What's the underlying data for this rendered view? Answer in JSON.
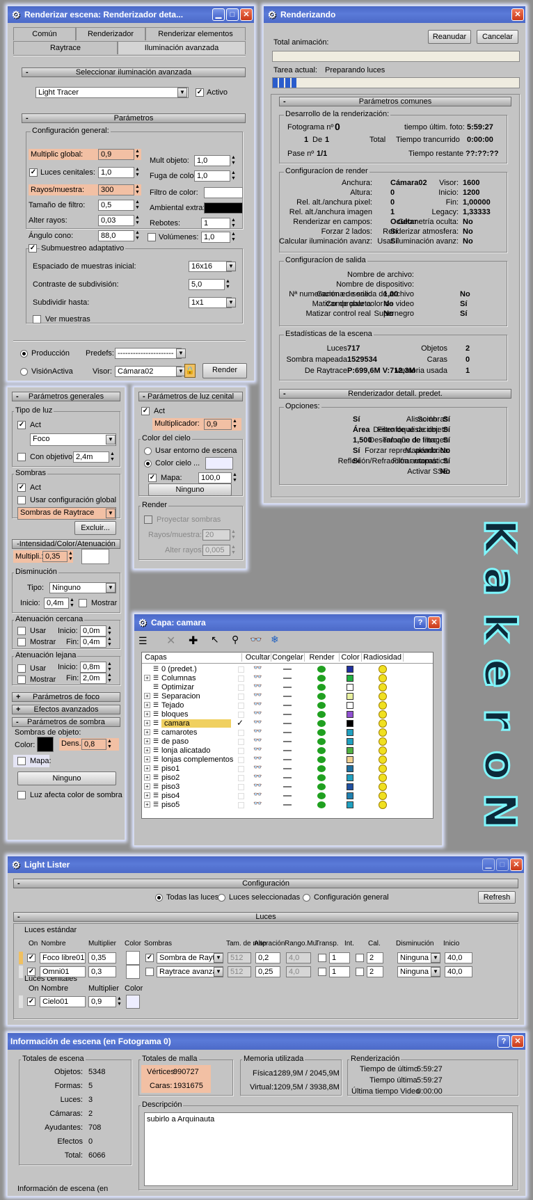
{
  "render_window": {
    "title": "Renderizar escena: Renderizador deta...",
    "tabs_row1": [
      "Común",
      "Renderizador",
      "Renderizar elementos"
    ],
    "tabs_row2": [
      "Raytrace",
      "Iluminación avanzada"
    ],
    "sel_rollout": "Seleccionar iluminación avanzada",
    "engine": "Light Tracer",
    "activo": "Activo",
    "params_rollout": "Parámetros",
    "config_general": "Configuración general:",
    "multiplic_global": "Multiplic global:",
    "multiplic_global_val": "0,9",
    "luces_cenitales": "Luces cenitales:",
    "luces_cenitales_val": "1,0",
    "rayos_muestra": "Rayos/muestra:",
    "rayos_muestra_val": "300",
    "tam_filtro": "Tamaño de filtro:",
    "tam_filtro_val": "0,5",
    "alter_rayos": "Alter rayos:",
    "alter_rayos_val": "0,03",
    "angulo_cono": "Ángulo cono:",
    "angulo_cono_val": "88,0",
    "mult_objeto": "Mult objeto:",
    "mult_objeto_val": "1,0",
    "fuga_color": "Fuga de color:",
    "fuga_color_val": "1,0",
    "filtro_color": "Filtro de color:",
    "ambiental_extra": "Ambiental extra:",
    "rebotes": "Rebotes:",
    "rebotes_val": "1",
    "volumenes": "Volúmenes:",
    "volumenes_val": "1,0",
    "submuestreo": "Submuestreo adaptativo",
    "espaciado": "Espaciado de muestras inicial:",
    "espaciado_val": "16x16",
    "contraste": "Contraste de subdivisión:",
    "contraste_val": "5,0",
    "subdividir": "Subdividir hasta:",
    "subdividir_val": "1x1",
    "ver_muestras": "Ver muestras",
    "produccion": "Producción",
    "vision_activa": "VisiónActiva",
    "predefs": "Predefs:",
    "predefs_val": "----------------------",
    "visor": "Visor:",
    "visor_val": "Cámara02",
    "render_btn": "Render"
  },
  "progress_window": {
    "title": "Renderizando",
    "total_anim": "Total animación:",
    "reanudar": "Reanudar",
    "cancelar": "Cancelar",
    "tarea_actual": "Tarea actual:",
    "tarea_val": "Preparando luces",
    "progress": 0.1,
    "params_comunes": "Parámetros comunes",
    "desarrollo": "Desarrollo de la renderización:",
    "fotograma": "Fotograma nº",
    "fotograma_val": "0",
    "de_val": "1",
    "de": "De",
    "de_total": "1",
    "total": "Total",
    "pase": "Pase nº",
    "pase_val": "1/1",
    "tiempo_ultim": "tiempo últim. foto:",
    "tiempo_ultim_val": "5:59:27",
    "tiempo_trans": "Tiempo trancurrido",
    "tiempo_trans_val": "0:00:00",
    "tiempo_rest": "Tiempo restante",
    "tiempo_rest_val": "??:??:??",
    "config_render": "Configuracíon de render",
    "cr_rows": [
      [
        "Visor:",
        "Cámara02",
        "Anchura:",
        "1600"
      ],
      [
        "Inicio:",
        "0",
        "Altura:",
        "1200"
      ],
      [
        "Fin:",
        "0",
        "Rel. alt./anchura pixel:",
        "1,00000"
      ],
      [
        "Legacy:",
        "1",
        "Rel. alt./anchura imagen",
        "1,33333"
      ],
      [
        "Geometría oculta:",
        "Ocultar",
        "Renderizar en campos:",
        "No"
      ],
      [
        "Renderizar atmosfera:",
        "Sí",
        "Forzar 2 lados:",
        "No"
      ],
      [
        "Usar iluminación avanz:",
        "Sí",
        "Calcular iluminación avanz:",
        "No"
      ]
    ],
    "config_salida": "Configuracíon de salida",
    "cs_rows": [
      [
        "Nombre de archivo:",
        "",
        "",
        ""
      ],
      [
        "Nombre de dispositivo:",
        "",
        "",
        ""
      ],
      [
        "Gamma de salida de archivo",
        "1,00",
        "Nª numeración en serie:",
        "No"
      ],
      [
        "Comprobar color de video",
        "No",
        "Matizar de paleta",
        "Sí"
      ],
      [
        "Supernegro",
        "No",
        "Matizar control real",
        "Sí"
      ]
    ],
    "estadisticas": "Estadísticas de la escena",
    "es_rows": [
      [
        "Objetos",
        "717",
        "Luces",
        "2"
      ],
      [
        "Caras",
        "1529534",
        "Sombra mapeada",
        "0"
      ],
      [
        "Memoria usada",
        "P:699,6M V:712,3M",
        "De Raytrace",
        "1"
      ]
    ],
    "renderizador_detall": "Renderizador detall. predet.",
    "opciones": "Opciones:",
    "op_rows": [
      [
        "Alisación:",
        "Sí",
        "Sombras:",
        "Sí"
      ],
      [
        "Filtro de alisación:",
        "Área",
        "Desenfoque de objeto:",
        "Sí"
      ],
      [
        "Tamaño de filtro:",
        "1,500",
        "Desenfoque de imagen:",
        "Sí"
      ],
      [
        "Mapeado:",
        "Sí",
        "Forzar repres. alámbrica:",
        "No"
      ],
      [
        "Filtrar mapas:",
        "Sí",
        "Reflexión/Refracción automática:",
        "Sí"
      ],
      [
        "",
        "",
        "Activar SSE:",
        "No"
      ]
    ]
  },
  "light_panel": {
    "param_generales": "Parámetros generales",
    "tipo_luz": "Tipo de luz",
    "act": "Act",
    "tipo_val": "Foco",
    "con_objetivo": "Con objetivo",
    "con_objetivo_val": "2,4m",
    "sombras": "Sombras",
    "usar_config_global": "Usar configuración global",
    "sombras_val": "Sombras de  Raytrace",
    "excluir": "Excluir...",
    "intensidad": "-Intensidad/Color/Atenuación",
    "multipli": "Multipli.:",
    "multipli_val": "0,35",
    "disminucion": "Disminución",
    "tipo": "Tipo:",
    "tipo_dis_val": "Ninguno",
    "inicio": "Inicio:",
    "inicio_val": "0,4m",
    "mostrar": "Mostrar",
    "aten_cercana": "Atenuación cercana",
    "aten_lejana": "Atenuación lejana",
    "usar": "Usar",
    "fin": "Fin:",
    "ac_inicio": "0,0m",
    "ac_fin": "0,4m",
    "al_inicio": "0,8m",
    "al_fin": "2,0m",
    "param_foco": "Parámetros de foco",
    "efectos_avanzados": "Efectos avanzados",
    "param_sombra": "Parámetros de sombra",
    "sombras_objeto": "Sombras de objeto:",
    "color": "Color:",
    "dens": "Dens.",
    "dens_val": "0,8",
    "mapa": "Mapa:",
    "ninguno": "Ninguno",
    "luz_afecta": "Luz afecta color de sombra"
  },
  "skylight_panel": {
    "title": "Parámetros de luz cenital",
    "act": "Act",
    "multiplicador": "Multiplicador:",
    "multiplicador_val": "0,9",
    "color_cielo_grp": "Color del cielo",
    "usar_entorno": "Usar entorno de escena",
    "color_cielo": "Color cielo ...",
    "mapa": "Mapa:",
    "mapa_val": "100,0",
    "ninguno": "Ninguno",
    "render": "Render",
    "proyectar": "Proyectar sombras",
    "rayos": "Rayos/muestra:",
    "rayos_val": "20",
    "alter": "Alter rayos:",
    "alter_val": "0,005"
  },
  "layer_window": {
    "title": "Capa: camara",
    "headers": [
      "Capas",
      "Ocultar",
      "Congelar",
      "Render",
      "Color",
      "Radiosidad"
    ],
    "layers": [
      {
        "name": "0 (predet.)",
        "color": "#2030a0",
        "plus": false
      },
      {
        "name": "Columnas",
        "color": "#20b040",
        "plus": true
      },
      {
        "name": "Optimizar",
        "color": "#ffffff",
        "plus": false
      },
      {
        "name": "Separacion",
        "color": "#e8f0a0",
        "plus": true
      },
      {
        "name": "Tejado",
        "color": "#ffffff",
        "plus": true
      },
      {
        "name": "bloques",
        "color": "#9050d0",
        "plus": true
      },
      {
        "name": "camara",
        "color": "#000000",
        "plus": true
      },
      {
        "name": "camarotes",
        "color": "#20a0c0",
        "plus": true
      },
      {
        "name": "de paso",
        "color": "#20a0c0",
        "plus": true
      },
      {
        "name": "lonja alicatado",
        "color": "#50b040",
        "plus": true
      },
      {
        "name": "lonjas complementos",
        "color": "#f0d090",
        "plus": true
      },
      {
        "name": "piso1",
        "color": "#2070a0",
        "plus": true
      },
      {
        "name": "piso2",
        "color": "#20a0c0",
        "plus": true
      },
      {
        "name": "piso3",
        "color": "#2050a0",
        "plus": true
      },
      {
        "name": "piso4",
        "color": "#2080b0",
        "plus": true
      },
      {
        "name": "piso5",
        "color": "#20a0c0",
        "plus": true
      }
    ]
  },
  "light_lister": {
    "title": "Light Lister",
    "configuracion": "Configuración",
    "todas": "Todas las luces",
    "seleccionadas": "Luces seleccionadas",
    "config_general": "Configuración general",
    "refresh": "Refresh",
    "luces": "Luces",
    "luces_estandar": "Luces estándar",
    "on": "On",
    "nombre": "Nombre",
    "multiplier": "Multiplier",
    "color": "Color",
    "sombras": "Sombras",
    "tam_map": "Tam. de map",
    "alteracion": "Alteración",
    "rango_mu": "Rango.Mu",
    "transp": "Transp.",
    "int": "Int.",
    "cal": "Cal.",
    "disminucion": "Disminución",
    "inicio": "Inicio",
    "rows": [
      {
        "name": "Foco libre01",
        "mult": "0,35",
        "shadow": "Sombra de Raytra",
        "tam": "512",
        "alt": "0,2",
        "rango": "4,0",
        "int": "1",
        "cal": "2",
        "dis": "Ninguna",
        "ini": "40,0"
      },
      {
        "name": "Omni01",
        "mult": "0,3",
        "shadow": "Raytrace avanzac",
        "tam": "512",
        "alt": "0,25",
        "rango": "4,0",
        "int": "1",
        "cal": "2",
        "dis": "Ninguna",
        "ini": "40,0"
      }
    ],
    "luces_cenitales": "Luces cenitales",
    "sky_name": "Cielo01",
    "sky_mult": "0,9"
  },
  "scene_info": {
    "title": "Información de escena (en Fotograma 0)",
    "totales_escena": "Totales de escena",
    "te_rows": [
      [
        "Objetos:",
        "5348"
      ],
      [
        "Formas:",
        "5"
      ],
      [
        "Luces:",
        "3"
      ],
      [
        "Cámaras:",
        "2"
      ],
      [
        "Ayudantes:",
        "708"
      ],
      [
        "Efectos",
        "0"
      ],
      [
        "Total:",
        "6066"
      ]
    ],
    "totales_malla": "Totales de malla",
    "vertices": "Vértices:",
    "vertices_val": "990727",
    "caras": "Caras:",
    "caras_val": "1931675",
    "memoria": "Memoria utilizada",
    "fisica": "Física:",
    "fisica_val": "1289,9M / 2045,9M",
    "virtual": "Virtual:",
    "virtual_val": "1209,5M / 3938,8M",
    "renderizacion": "Renderización",
    "tiempo_ultimo": "Tiempo de último",
    "tiempo_ultimo_val": "5:59:27",
    "tiempo_ultima": "Tiempo última",
    "tiempo_ultima_val": "5:59:27",
    "ultima_video": "Última tiempo Video",
    "ultima_video_val": "0:00:00",
    "descripcion": "Descripción",
    "desc_text": "subirlo a Arquinauta",
    "footer": "Información de escena (en"
  },
  "watermark": "KakeroN",
  "colors": {
    "orange": "#f2c0a4",
    "title": "#4a68c8",
    "sky_color": "#eeeeff"
  }
}
